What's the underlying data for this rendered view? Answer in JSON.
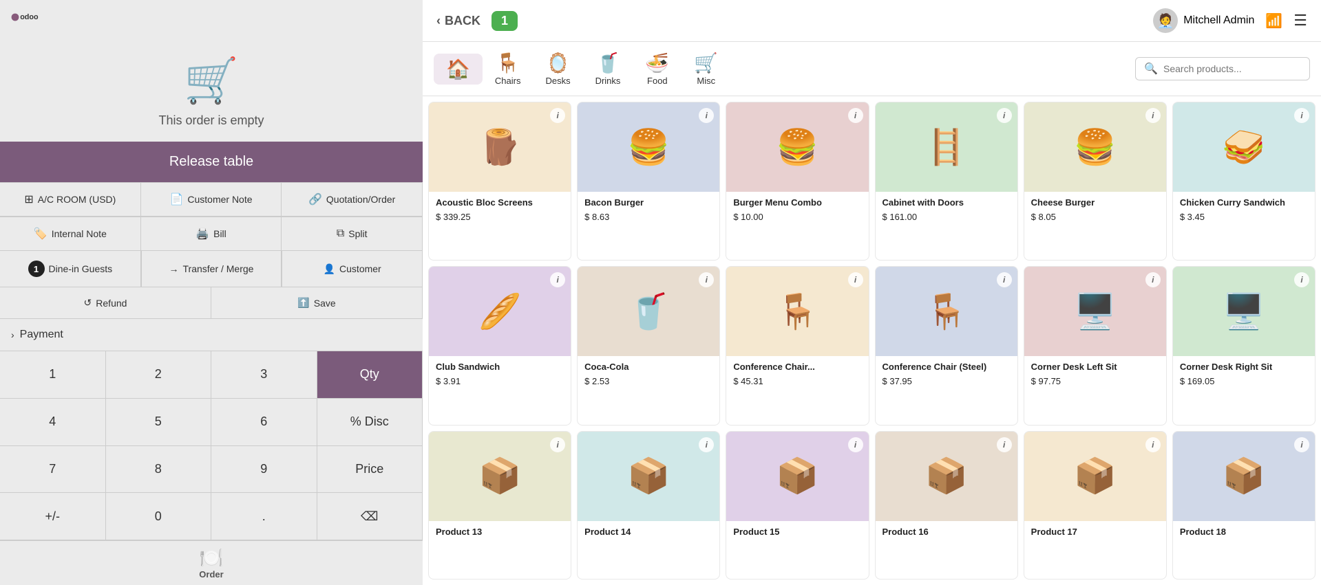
{
  "app": {
    "logo_text": "odoo"
  },
  "left_panel": {
    "empty_order_text": "This order is empty",
    "release_table_label": "Release table",
    "actions": {
      "ac_room": "A/C ROOM (USD)",
      "customer_note": "Customer Note",
      "quotation_order": "Quotation/Order",
      "internal_note": "Internal Note",
      "bill": "Bill",
      "split": "Split",
      "dine_in_guests": "Dine-in Guests",
      "dine_in_count": "1",
      "transfer_merge": "Transfer / Merge",
      "customer": "Customer",
      "refund": "Refund",
      "save": "Save",
      "payment": "Payment"
    },
    "numpad": {
      "keys": [
        "1",
        "2",
        "3",
        "Qty",
        "4",
        "5",
        "6",
        "% Disc",
        "7",
        "8",
        "9",
        "Price",
        "+/-",
        "0",
        ".",
        "⌫"
      ],
      "active_key": "Qty"
    },
    "order_tab_label": "Order"
  },
  "top_bar": {
    "back_label": "BACK",
    "order_number": "1",
    "user_name": "Mitchell Admin"
  },
  "categories": [
    {
      "id": "home",
      "label": "",
      "icon": "🏠",
      "active": true
    },
    {
      "id": "chairs",
      "label": "Chairs",
      "icon": "🪑"
    },
    {
      "id": "desks",
      "label": "Desks",
      "icon": "🪞"
    },
    {
      "id": "drinks",
      "label": "Drinks",
      "icon": "🥤"
    },
    {
      "id": "food",
      "label": "Food",
      "icon": "🍜"
    },
    {
      "id": "misc",
      "label": "Misc",
      "icon": "🛒"
    }
  ],
  "search": {
    "placeholder": "Search products..."
  },
  "products": [
    {
      "id": 1,
      "name": "Acoustic Bloc Screens",
      "price": "$ 339.25",
      "emoji": "🪵"
    },
    {
      "id": 2,
      "name": "Bacon Burger",
      "price": "$ 8.63",
      "emoji": "🍔"
    },
    {
      "id": 3,
      "name": "Burger Menu Combo",
      "price": "$ 10.00",
      "emoji": "🍔"
    },
    {
      "id": 4,
      "name": "Cabinet with Doors",
      "price": "$ 161.00",
      "emoji": "🪜"
    },
    {
      "id": 5,
      "name": "Cheese Burger",
      "price": "$ 8.05",
      "emoji": "🍔"
    },
    {
      "id": 6,
      "name": "Chicken Curry Sandwich",
      "price": "$ 3.45",
      "emoji": "🥪"
    },
    {
      "id": 7,
      "name": "Club Sandwich",
      "price": "$ 3.91",
      "emoji": "🥖"
    },
    {
      "id": 8,
      "name": "Coca-Cola",
      "price": "$ 2.53",
      "emoji": "🥤"
    },
    {
      "id": 9,
      "name": "Conference Chair...",
      "price": "$ 45.31",
      "emoji": "🪑"
    },
    {
      "id": 10,
      "name": "Conference Chair (Steel)",
      "price": "$ 37.95",
      "emoji": "🪑"
    },
    {
      "id": 11,
      "name": "Corner Desk Left Sit",
      "price": "$ 97.75",
      "emoji": "🖥️"
    },
    {
      "id": 12,
      "name": "Corner Desk Right Sit",
      "price": "$ 169.05",
      "emoji": "🖥️"
    },
    {
      "id": 13,
      "name": "Product 13",
      "price": "",
      "emoji": "📦"
    },
    {
      "id": 14,
      "name": "Product 14",
      "price": "",
      "emoji": "📦"
    },
    {
      "id": 15,
      "name": "Product 15",
      "price": "",
      "emoji": "📦"
    },
    {
      "id": 16,
      "name": "Product 16",
      "price": "",
      "emoji": "📦"
    },
    {
      "id": 17,
      "name": "Product 17",
      "price": "",
      "emoji": "📦"
    },
    {
      "id": 18,
      "name": "Product 18",
      "price": "",
      "emoji": "📦"
    }
  ]
}
